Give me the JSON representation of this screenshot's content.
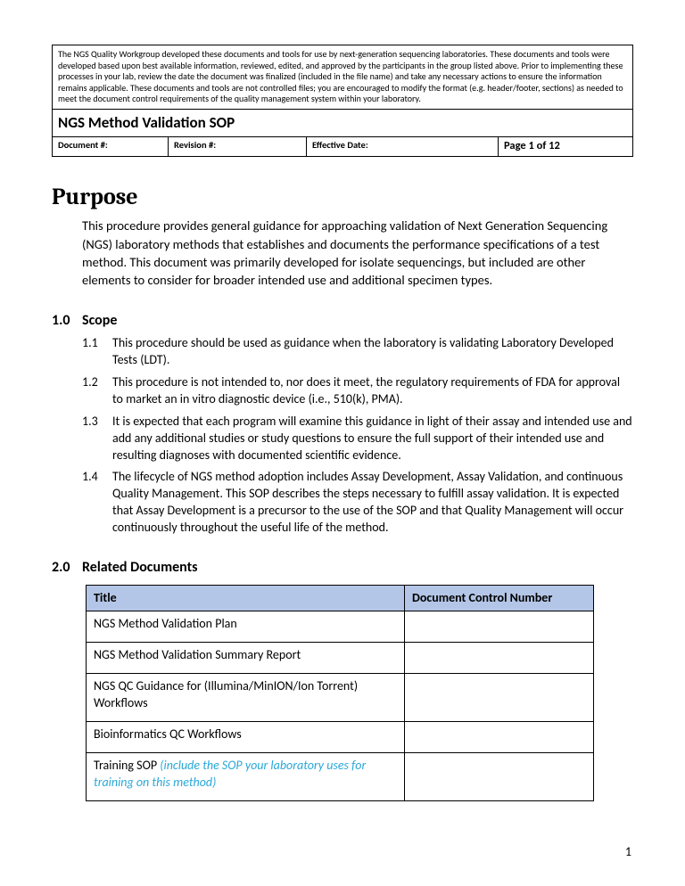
{
  "header": {
    "disclaimer": "The NGS Quality Workgroup developed these documents and tools for use by next-generation sequencing laboratories. These documents and tools were developed based upon best available information, reviewed, edited, and approved by the participants in the group listed above. Prior to implementing these processes in your lab, review the date the document was finalized (included in the file name) and take any necessary actions to ensure the information remains applicable. These documents and tools are not controlled files; you are encouraged to modify the format (e.g. header/footer, sections) as needed to meet the document control requirements of the quality management system within your laboratory.",
    "title": "NGS Method Validation SOP",
    "meta": {
      "doc_num_label": "Document #:",
      "rev_num_label": "Revision #:",
      "eff_date_label": "Effective Date:",
      "page_label": "Page 1 of 12"
    }
  },
  "purpose": {
    "heading": "Purpose",
    "body": "This procedure provides general guidance for approaching validation of Next Generation Sequencing (NGS) laboratory methods that establishes and documents the performance specifications of a test method. This document was primarily developed for isolate sequencings, but included are other elements to consider for broader intended use and additional specimen types."
  },
  "scope": {
    "num": "1.0",
    "heading": "Scope",
    "items": [
      {
        "n": "1.1",
        "t": "This procedure should be used as guidance when the laboratory is validating Laboratory Developed Tests (LDT)."
      },
      {
        "n": "1.2",
        "t": "This procedure is not intended to, nor does it meet, the regulatory requirements of FDA for approval to market an in vitro diagnostic device (i.e., 510(k), PMA)."
      },
      {
        "n": "1.3",
        "t": "It is expected that each program will examine this guidance in light of their assay and intended use and add any additional studies or study questions to ensure the full support of their intended use and resulting diagnoses with documented scientific evidence."
      },
      {
        "n": "1.4",
        "t": "The lifecycle of NGS method adoption includes Assay Development, Assay Validation, and continuous Quality Management. This SOP describes the steps necessary to fulfill assay validation. It is expected that Assay Development is a precursor to the use of the SOP and that Quality Management will occur continuously throughout the useful life of the method."
      }
    ]
  },
  "related": {
    "num": "2.0",
    "heading": "Related Documents",
    "col_title": "Title",
    "col_dcn": "Document Control Number",
    "rows": [
      {
        "title": "NGS Method Validation Plan",
        "dcn": ""
      },
      {
        "title": "NGS Method Validation Summary Report",
        "dcn": ""
      },
      {
        "title": "NGS QC Guidance for (Illumina/MinION/Ion Torrent) Workflows",
        "dcn": ""
      },
      {
        "title": "Bioinformatics QC Workflows",
        "dcn": ""
      },
      {
        "title_main": "Training SOP ",
        "title_note": "(include the SOP your laboratory uses for training on this method)",
        "dcn": ""
      }
    ]
  },
  "page_number": "1"
}
